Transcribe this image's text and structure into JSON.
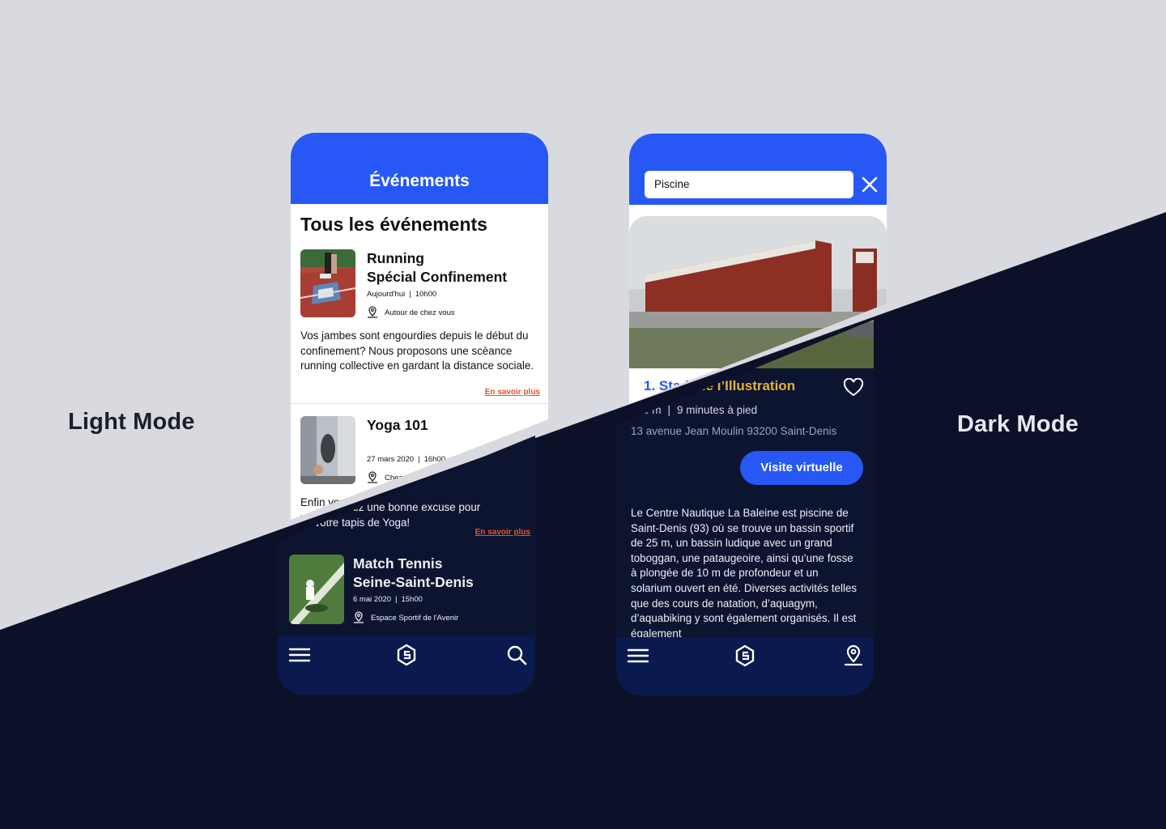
{
  "labels": {
    "light_mode": "Light Mode",
    "dark_mode": "Dark Mode"
  },
  "events_screen": {
    "header_title": "Événements",
    "section_title": "Tous les événements",
    "events": [
      {
        "title_line1": "Running",
        "title_line2": "Spécial Confinement",
        "date": "Aujourd'hui",
        "time": "10h00",
        "location": "Autour de chez vous",
        "description": "Vos jambes sont engourdies depuis le début du confinement? Nous proposons une scèance running collective en gardant la distance sociale.",
        "more": "En savoir plus"
      },
      {
        "title_line1": "Yoga 101",
        "date": "27 mars 2020",
        "time": "16h00",
        "location": "Chez vous",
        "description": "Enfin vous avez une bonne excuse pour sortir votre tapis de Yoga!",
        "more": "En savoir plus"
      },
      {
        "title_line1": "Match Tennis",
        "title_line2": "Seine-Saint-Denis",
        "date": "6 mai 2020",
        "time": "15h00",
        "location": "Espace Sportif de l'Avenir"
      }
    ],
    "nav": {
      "left_icon": "menu-icon",
      "center_icon": "logo-icon",
      "right_icon": "search-icon"
    }
  },
  "search_screen": {
    "search_value": "Piscine",
    "result": {
      "number": "1. Stad",
      "name": "e de l’Illustration",
      "distance": "700 m",
      "walk": "9 minutes à pied",
      "address": "13 avenue Jean Moulin 93200 Saint-Denis",
      "cta": "Visite virtuelle",
      "description": "Le Centre Nautique La Baleine est piscine de Saint-Denis (93) où se trouve un bassin sportif de 25 m, un bassin ludique avec un grand toboggan, une pataugeoire, ainsi qu’une fosse à plongée de 10 m de profondeur et un solarium ouvert en été. Diverses activités telles que des cours de natation, d’aquagym, d’aquabiking y sont également organisés. Il est également"
    },
    "nav": {
      "left_icon": "menu-icon",
      "center_icon": "logo-icon",
      "right_icon": "map-pin-icon"
    }
  },
  "colors": {
    "accent": "#2758f5",
    "link": "#e8532a",
    "highlight": "#e0b43a",
    "dark_bg": "#0c1129",
    "nav_bg": "#0a1a4f"
  }
}
